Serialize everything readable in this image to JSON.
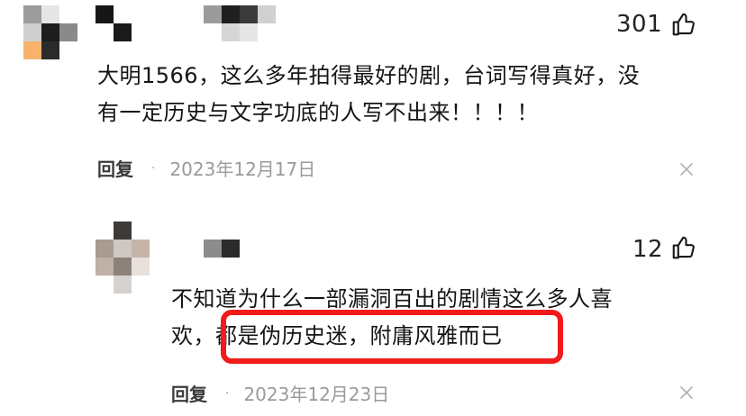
{
  "comments": [
    {
      "likes": "301",
      "text_line1": "大明1566，这么多年拍得最好的剧，台词写得真好，没",
      "text_line2": "有一定历史与文字功底的人写不出来！！！！",
      "reply_label": "回复",
      "separator": "·",
      "date": "2023年12月17日"
    },
    {
      "likes": "12",
      "text_line1": "不知道为什么一部漏洞百出的剧情这么多人喜",
      "text_line2": "欢，都是伪历史迷，附庸风雅而已",
      "reply_label": "回复",
      "separator": "·",
      "date": "2023年12月23日"
    }
  ],
  "icons": {
    "like": "thumbs-up-icon",
    "close": "close-icon"
  },
  "colors": {
    "highlight_border": "#f21b1b",
    "meta_text": "#9a9a9a"
  }
}
